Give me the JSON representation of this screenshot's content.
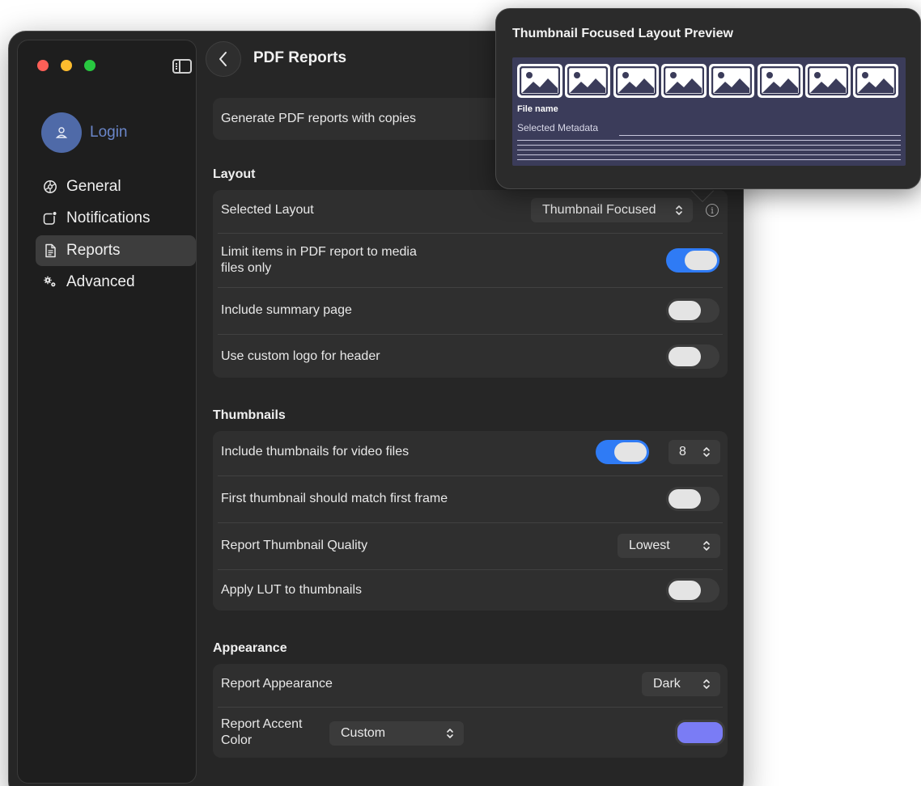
{
  "window": {
    "title": "PDF Reports"
  },
  "sidebar": {
    "login_label": "Login",
    "items": [
      {
        "label": "General",
        "icon": "gear-icon"
      },
      {
        "label": "Notifications",
        "icon": "notification-badge-icon"
      },
      {
        "label": "Reports",
        "icon": "document-icon",
        "active": true
      },
      {
        "label": "Advanced",
        "icon": "gears-icon"
      }
    ]
  },
  "rows": {
    "generate_copies": "Generate PDF reports with copies"
  },
  "layout": {
    "section_title": "Layout",
    "selected_layout_label": "Selected Layout",
    "selected_layout_value": "Thumbnail Focused",
    "limit_media_label": "Limit items in PDF report to media files only",
    "limit_media_on": true,
    "summary_label": "Include summary page",
    "summary_on": false,
    "logo_label": "Use custom logo for header",
    "logo_on": false
  },
  "thumbnails": {
    "section_title": "Thumbnails",
    "video_label": "Include thumbnails for video files",
    "video_on": true,
    "video_count": "8",
    "first_frame_label": "First thumbnail should match first frame",
    "first_frame_on": false,
    "quality_label": "Report Thumbnail Quality",
    "quality_value": "Lowest",
    "lut_label": "Apply LUT to thumbnails",
    "lut_on": false
  },
  "appearance": {
    "section_title": "Appearance",
    "appearance_label": "Report Appearance",
    "appearance_value": "Dark",
    "accent_label": "Report Accent Color",
    "accent_value": "Custom",
    "accent_color": "#7a7cf5"
  },
  "popover": {
    "title": "Thumbnail Focused Layout Preview",
    "file_name": "File name",
    "selected_metadata": "Selected Metadata",
    "thumbnail_count": 8
  },
  "colors": {
    "toggle_on": "#2f7bf5",
    "login_accent": "#6a86c9",
    "preview_bg": "#3b3c5a"
  }
}
